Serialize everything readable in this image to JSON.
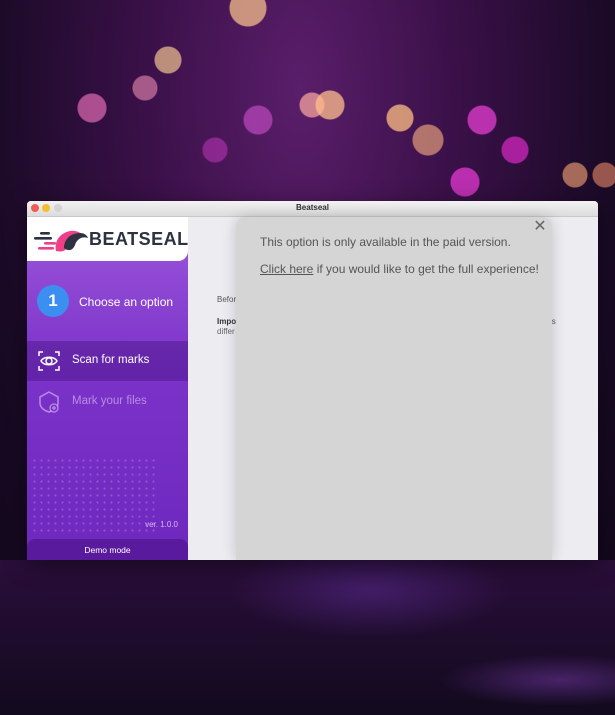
{
  "window": {
    "title": "Beatseal"
  },
  "sidebar": {
    "logo_text": "BEATSEAL",
    "step": {
      "number": "1",
      "label": "Choose an option"
    },
    "nav": [
      {
        "label": "Scan for marks",
        "icon": "eye-scan-icon",
        "state": "active"
      },
      {
        "label": "Mark your files",
        "icon": "shield-plus-icon",
        "state": "disabled"
      }
    ],
    "version": "ver. 1.0.0",
    "demo_mode": "Demo mode"
  },
  "main": {
    "behind_text_1": "Befor",
    "behind_text_2": "Impo",
    "behind_text_3": "differ",
    "behind_text_4": "is"
  },
  "modal": {
    "message": "This option is only available in the paid version.",
    "link_text": "Click here",
    "cta_rest": " if you would like to get the full experience!",
    "close_icon": "close-icon"
  },
  "colors": {
    "sidebar_top": "#9d57db",
    "sidebar_bottom": "#6e28be",
    "step_circle": "#3a8ff0",
    "logo_text": "#2d3140",
    "logo_accent": "#ef3f86",
    "modal_bg": "#d5d5d5"
  }
}
